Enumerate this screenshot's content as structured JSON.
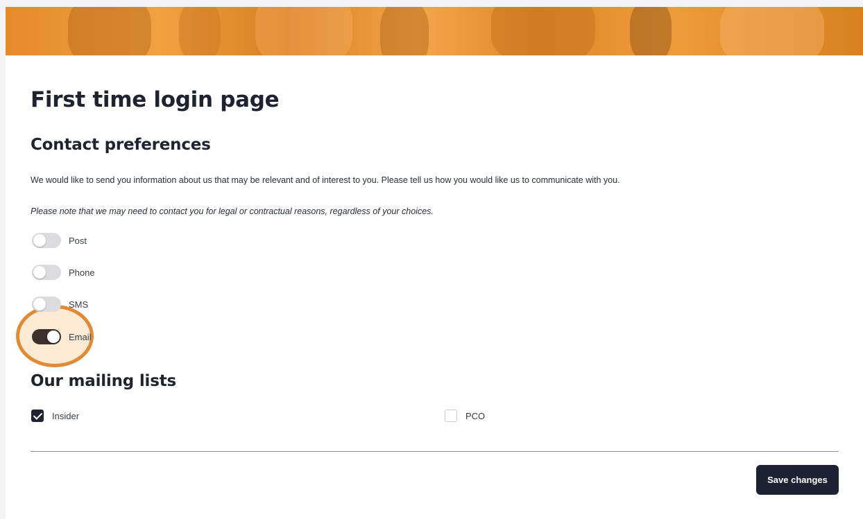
{
  "page": {
    "title": "First time login page"
  },
  "contact_preferences": {
    "heading": "Contact preferences",
    "intro": "We would like to send you information about us that may be relevant and of interest to you. Please tell us how you would like us to communicate with you.",
    "note": "Please note that we may need to contact you for legal or contractual reasons, regardless of your choices.",
    "toggles": [
      {
        "label": "Post",
        "on": false
      },
      {
        "label": "Phone",
        "on": false
      },
      {
        "label": "SMS",
        "on": false
      },
      {
        "label": "Email",
        "on": true
      }
    ]
  },
  "mailing_lists": {
    "heading": "Our mailing lists",
    "items": [
      {
        "label": "Insider",
        "checked": true
      },
      {
        "label": "PCO",
        "checked": false
      }
    ]
  },
  "actions": {
    "save_label": "Save changes"
  },
  "colors": {
    "banner": "#e58a2a",
    "highlight": "#e08a33",
    "primary": "#1d2233",
    "toggle_on": "#3b302c"
  }
}
